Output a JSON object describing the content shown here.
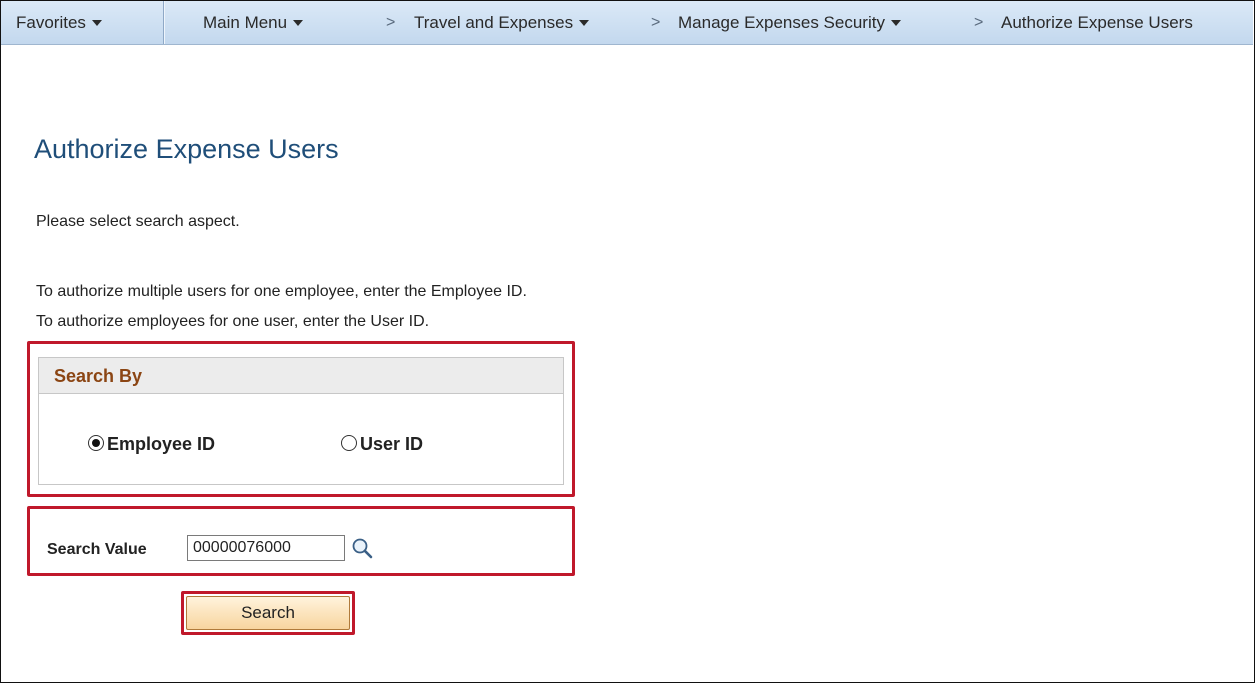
{
  "nav": {
    "favorites": "Favorites",
    "main_menu": "Main Menu",
    "separator": ">",
    "breadcrumbs": [
      "Travel and Expenses",
      "Manage Expenses Security",
      "Authorize Expense Users"
    ]
  },
  "page": {
    "title": "Authorize Expense Users",
    "instruction": "Please select search aspect.",
    "help_line_1": "To authorize multiple users for one employee, enter the Employee ID.",
    "help_line_2": "To authorize employees for one user, enter the User ID."
  },
  "search_by": {
    "header": "Search By",
    "options": [
      {
        "label": "Employee ID",
        "selected": true
      },
      {
        "label": "User ID",
        "selected": false
      }
    ]
  },
  "search_value": {
    "label": "Search Value",
    "value": "00000076000"
  },
  "search_button": {
    "label": "Search"
  },
  "colors": {
    "highlight": "#c0182b",
    "title": "#1f4e79",
    "group_header": "#8b4513",
    "nav_bg": "#c3d8ee"
  }
}
